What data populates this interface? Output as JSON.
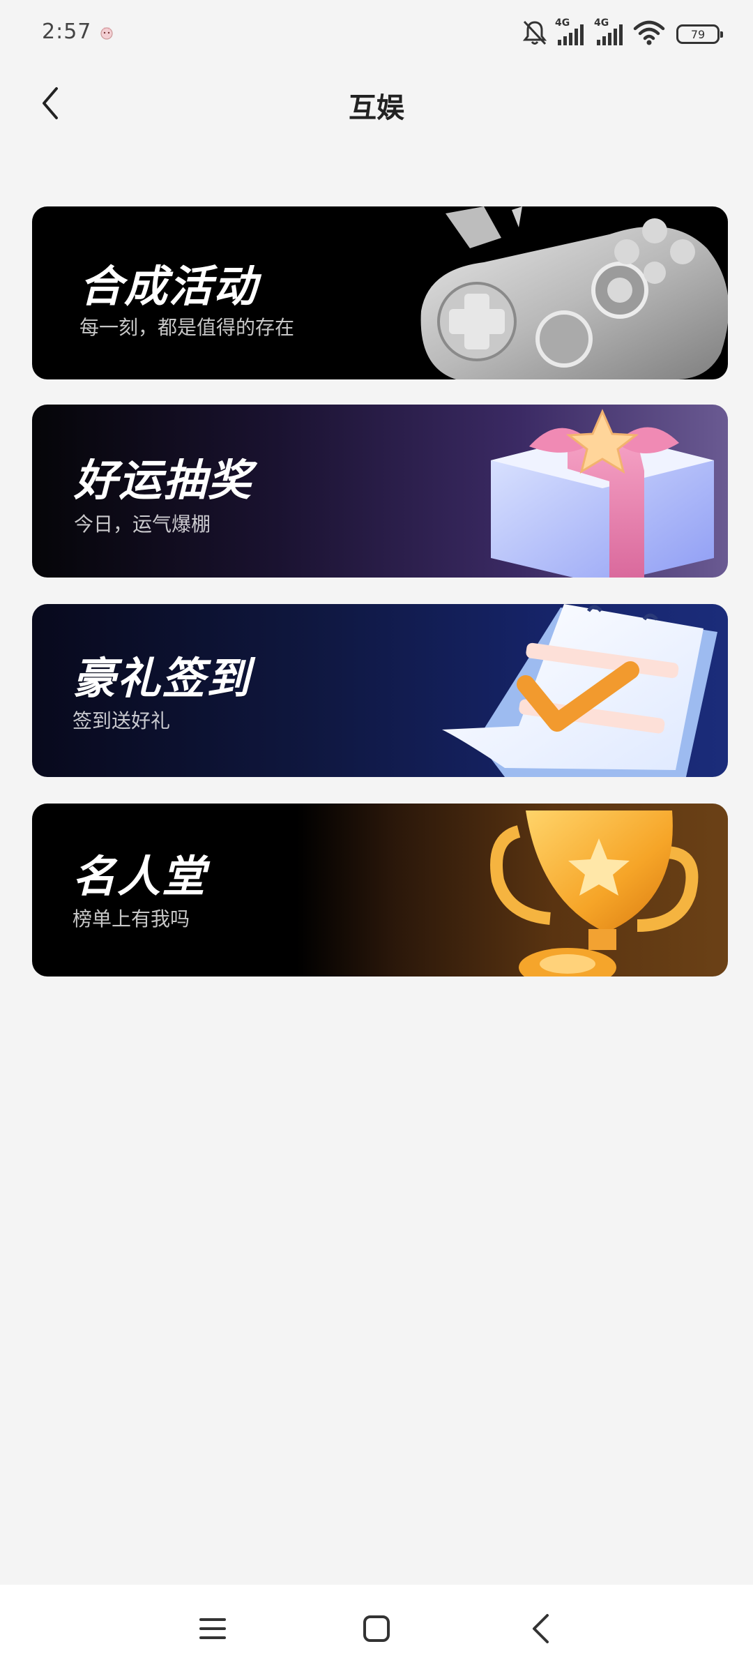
{
  "status_bar": {
    "time": "2:57",
    "network_1": "4G",
    "network_2": "4G",
    "battery": "79",
    "icons": [
      "app-notification-icon",
      "bell-muted-icon",
      "signal-icon",
      "signal-icon",
      "wifi-icon",
      "battery-icon"
    ]
  },
  "header": {
    "title": "互娱",
    "back_icon": "chevron-left-icon"
  },
  "cards": [
    {
      "title": "合成活动",
      "subtitle": "每一刻，都是值得的存在",
      "art_icon": "gamepad-icon"
    },
    {
      "title": "好运抽奖",
      "subtitle": "今日，运气爆棚",
      "art_icon": "gift-box-icon"
    },
    {
      "title": "豪礼签到",
      "subtitle": "签到送好礼",
      "art_icon": "calendar-check-icon"
    },
    {
      "title": "名人堂",
      "subtitle": "榜单上有我吗",
      "art_icon": "trophy-icon"
    }
  ],
  "nav_bar": {
    "icons": [
      "menu-icon",
      "home-square-icon",
      "back-triangle-icon"
    ]
  },
  "colors": {
    "background": "#f4f4f4",
    "card_text": "#ffffff",
    "title_text": "#222222"
  }
}
